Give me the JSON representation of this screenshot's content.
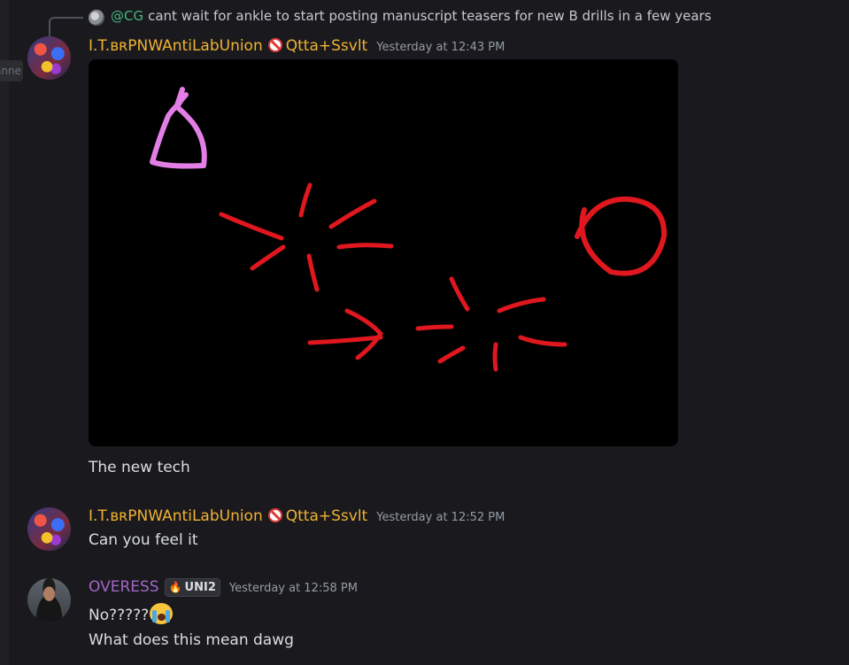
{
  "left_tab": {
    "label": "anne"
  },
  "reply": {
    "mention": "@CG",
    "text": "cant wait for ankle to start posting manuscript teasers for new B drills in a few years"
  },
  "messages": [
    {
      "username": "I.T.ʙʀPNWAntiLabUnion",
      "tag": "Qtta+Ssvlt",
      "timestamp": "Yesterday at 12:43 PM",
      "text": "The new tech",
      "has_image": true
    },
    {
      "username": "I.T.ʙʀPNWAntiLabUnion",
      "tag": "Qtta+Ssvlt",
      "timestamp": "Yesterday at 12:52 PM",
      "text": "Can you feel it"
    },
    {
      "username": "OVERESS",
      "badge": "UNI2",
      "timestamp": "Yesterday at 12:58 PM",
      "lines": [
        "No?????",
        "What does this mean dawg"
      ],
      "emoji": "loudly-crying-face"
    }
  ],
  "colors": {
    "background": "#1a1a1e",
    "username_gold": "#f0b232",
    "username_purple": "#a266c7",
    "mention_green": "#43b581",
    "timestamp_gray": "#949ba4",
    "drawing_red": "#e0171f",
    "drawing_pink": "#e37ee6"
  }
}
